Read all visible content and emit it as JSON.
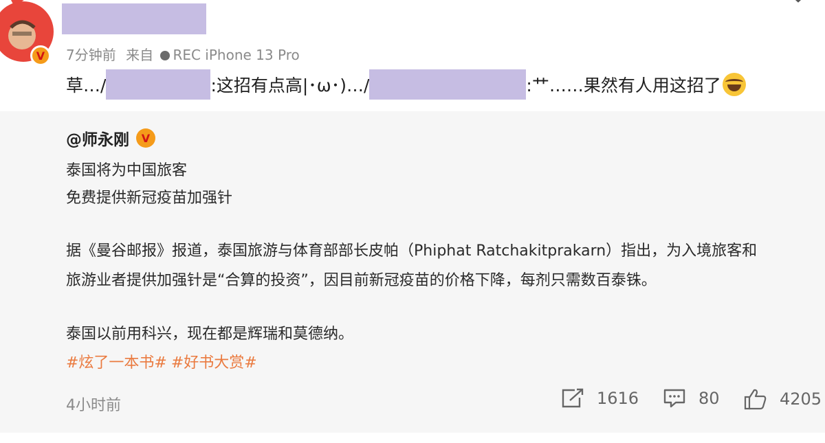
{
  "post": {
    "meta_time": "7分钟前",
    "meta_from": "来自",
    "meta_device": "REC iPhone 13 Pro",
    "repost_prefix": "草…/",
    "repost_mid": ":这招有点高|･ω･)…/",
    "repost_tail": ":艹……果然有人用这招了"
  },
  "quoted": {
    "author": "@师永刚",
    "lines": [
      "泰国将为中国旅客",
      "免费提供新冠疫苗加强针",
      "据《曼谷邮报》报道，泰国旅游与体育部部长皮帕（Phiphat Ratchakitprakarn）指出，为入境旅客和",
      "旅游业者提供加强针是“合算的投资”，因目前新冠疫苗的价格下降，每剂只需数百泰铢。",
      "泰国以前用科兴，现在都是辉瑞和莫德纳。"
    ],
    "tags": [
      "#炫了一本书#",
      "#好书大赏#"
    ],
    "time": "4小时前",
    "reposts": "1616",
    "comments": "80",
    "likes": "4205"
  },
  "colors": {
    "redaction": "#c6bde3",
    "tag": "#ea7a3f",
    "verify_badge": "#f59b1a",
    "quote_bg": "#f6f6f6"
  },
  "icons": {
    "avatar": "cartoon-avatar",
    "verified": "verified-v-badge",
    "menu": "chevron-down-icon",
    "emoji": "laugh-tears-emoji",
    "repost": "repost-icon",
    "comment": "comment-icon",
    "like": "thumbs-up-icon"
  }
}
